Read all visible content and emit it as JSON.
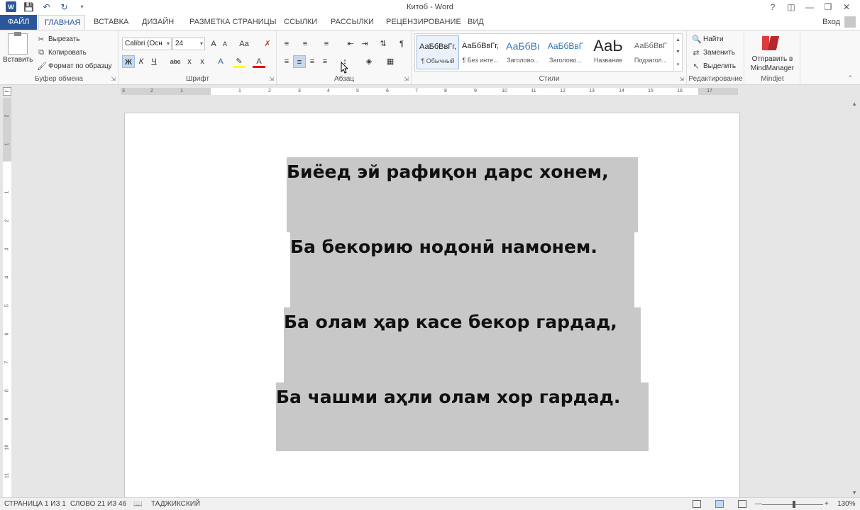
{
  "window": {
    "title": "Китоб - Word",
    "help": "?",
    "login": "Вход"
  },
  "quick_access": [
    "word-logo",
    "save-icon",
    "undo-icon",
    "redo-icon",
    "customize-icon"
  ],
  "tabs": [
    {
      "label": "ФАЙЛ"
    },
    {
      "label": "ГЛАВНАЯ"
    },
    {
      "label": "ВСТАВКА"
    },
    {
      "label": "ДИЗАЙН"
    },
    {
      "label": "РАЗМЕТКА СТРАНИЦЫ"
    },
    {
      "label": "ССЫЛКИ"
    },
    {
      "label": "РАССЫЛКИ"
    },
    {
      "label": "РЕЦЕНЗИРОВАНИЕ"
    },
    {
      "label": "ВИД"
    }
  ],
  "clipboard": {
    "paste": "Вставить",
    "cut": "Вырезать",
    "copy": "Копировать",
    "format_painter": "Формат по образцу",
    "label": "Буфер обмена"
  },
  "font": {
    "name": "Calibri (Осн",
    "size": "24",
    "grow": "A",
    "shrink": "A",
    "case": "Aa",
    "bold": "Ж",
    "italic": "К",
    "underline": "Ч",
    "strike": "abc",
    "subscript": "x",
    "superscript": "x",
    "label": "Шрифт"
  },
  "paragraph": {
    "label": "Абзац"
  },
  "styles": {
    "label": "Стили",
    "items": [
      {
        "sample": "АаБбВвГг,",
        "name": "¶ Обычный"
      },
      {
        "sample": "АаБбВвГг,",
        "name": "¶ Без инте..."
      },
      {
        "sample": "АаБбВı",
        "name": "Заголово..."
      },
      {
        "sample": "АаБбВвГ",
        "name": "Заголово..."
      },
      {
        "sample": "АаЬ",
        "name": "Название"
      },
      {
        "sample": "АаБбВвГ",
        "name": "Подзагол..."
      }
    ]
  },
  "editing": {
    "find": "Найти",
    "replace": "Заменить",
    "select": "Выделить",
    "label": "Редактирование"
  },
  "mindjet": {
    "send": "Отправить в",
    "send2": "MindManager",
    "label": "Mindjet"
  },
  "ruler": {
    "h_ticks": [
      "3",
      "2",
      "1",
      "1",
      "2",
      "3",
      "4",
      "5",
      "6",
      "7",
      "8",
      "9",
      "10",
      "11",
      "12",
      "13",
      "14",
      "15",
      "16",
      "17"
    ],
    "v_ticks": [
      "2",
      "1",
      "1",
      "2",
      "3",
      "4",
      "5",
      "6",
      "7",
      "8",
      "9",
      "10",
      "11"
    ]
  },
  "document": {
    "lines": [
      "Биёед эй рафиқон дарс хонем,",
      "Ба бекорию нодонӣ намонем.",
      "Ба олам ҳар касе бекор гардад,",
      "Ба чашми аҳли олам хор гардад."
    ]
  },
  "status": {
    "page": "СТРАНИЦА 1 ИЗ 1",
    "words": "СЛОВО 21 ИЗ 46",
    "language": "ТАДЖИКСКИЙ",
    "zoom": "130%"
  }
}
